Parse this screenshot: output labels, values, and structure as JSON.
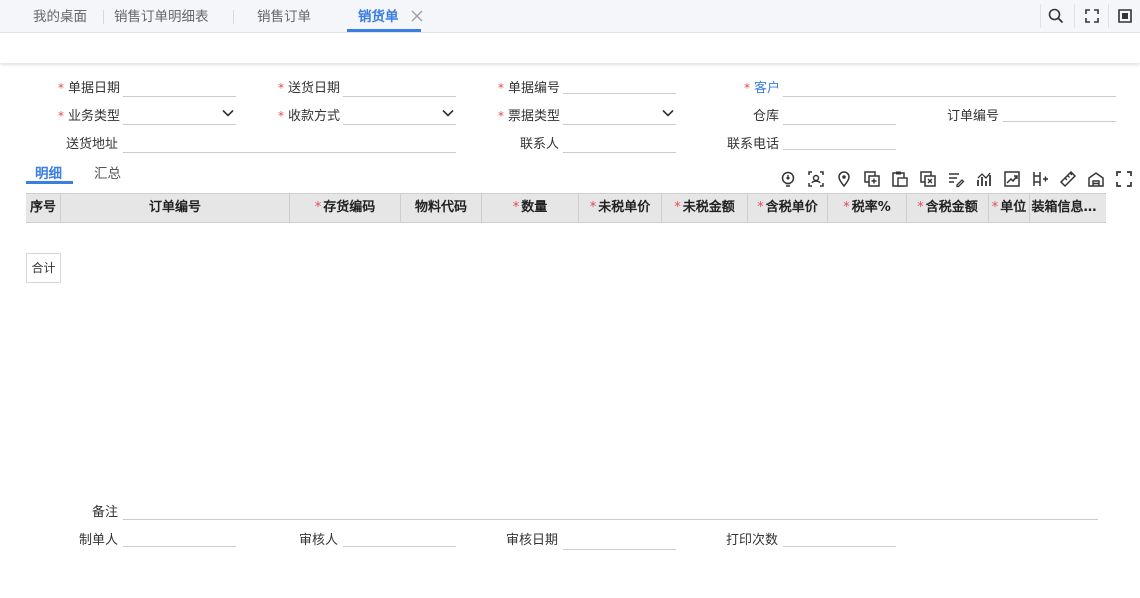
{
  "tabs": [
    {
      "label": "我的桌面"
    },
    {
      "label": "销售订单明细表"
    },
    {
      "label": "销售订单"
    },
    {
      "label": "销货单"
    }
  ],
  "topbar_icons": [
    "search-icon",
    "fit-screen-icon",
    "fullscreen-icon"
  ],
  "form": {
    "doc_date": {
      "label": "单据日期",
      "required": true,
      "value": ""
    },
    "ship_date": {
      "label": "送货日期",
      "required": true,
      "value": ""
    },
    "doc_no": {
      "label": "单据编号",
      "required": true,
      "value": ""
    },
    "customer": {
      "label": "客户",
      "required": true,
      "value": ""
    },
    "biz_type": {
      "label": "业务类型",
      "required": true,
      "value": ""
    },
    "payment_method": {
      "label": "收款方式",
      "required": true,
      "value": ""
    },
    "invoice_type": {
      "label": "票据类型",
      "required": true,
      "value": ""
    },
    "warehouse": {
      "label": "仓库",
      "value": ""
    },
    "order_no": {
      "label": "订单编号",
      "value": ""
    },
    "ship_address": {
      "label": "送货地址",
      "value": ""
    },
    "contact": {
      "label": "联系人",
      "value": ""
    },
    "phone": {
      "label": "联系电话",
      "value": ""
    }
  },
  "subtabs": [
    {
      "label": "明细"
    },
    {
      "label": "汇总"
    }
  ],
  "grid_icons": [
    "lightbulb-icon",
    "scan-icon",
    "location-icon",
    "copy-row-icon",
    "paste-icon",
    "delete-row-icon",
    "edit-list-icon",
    "chart-icon",
    "trend-icon",
    "split-icon",
    "ruler-icon",
    "warehouse-icon",
    "expand-icon"
  ],
  "grid": {
    "columns": [
      {
        "label": "序号",
        "required": false
      },
      {
        "label": "订单编号",
        "required": false
      },
      {
        "label": "存货编码",
        "required": true
      },
      {
        "label": "物料代码",
        "required": false
      },
      {
        "label": "数量",
        "required": true
      },
      {
        "label": "未税单价",
        "required": true
      },
      {
        "label": "未税金额",
        "required": true
      },
      {
        "label": "含税单价",
        "required": true
      },
      {
        "label": "税率%",
        "required": true
      },
      {
        "label": "含税金额",
        "required": true
      },
      {
        "label": "单位",
        "required": true
      },
      {
        "label": "装箱信息…",
        "required": false
      }
    ],
    "total_label": "合计"
  },
  "footer": {
    "remark": {
      "label": "备注",
      "value": ""
    },
    "creator": {
      "label": "制单人",
      "value": ""
    },
    "reviewer": {
      "label": "审核人",
      "value": ""
    },
    "review_date": {
      "label": "审核日期",
      "value": ""
    },
    "print_count": {
      "label": "打印次数",
      "value": ""
    }
  },
  "colors": {
    "accent": "#3b7ee3",
    "required_star": "#e24b4b",
    "grid_header_bg": "#e6e6e6"
  }
}
